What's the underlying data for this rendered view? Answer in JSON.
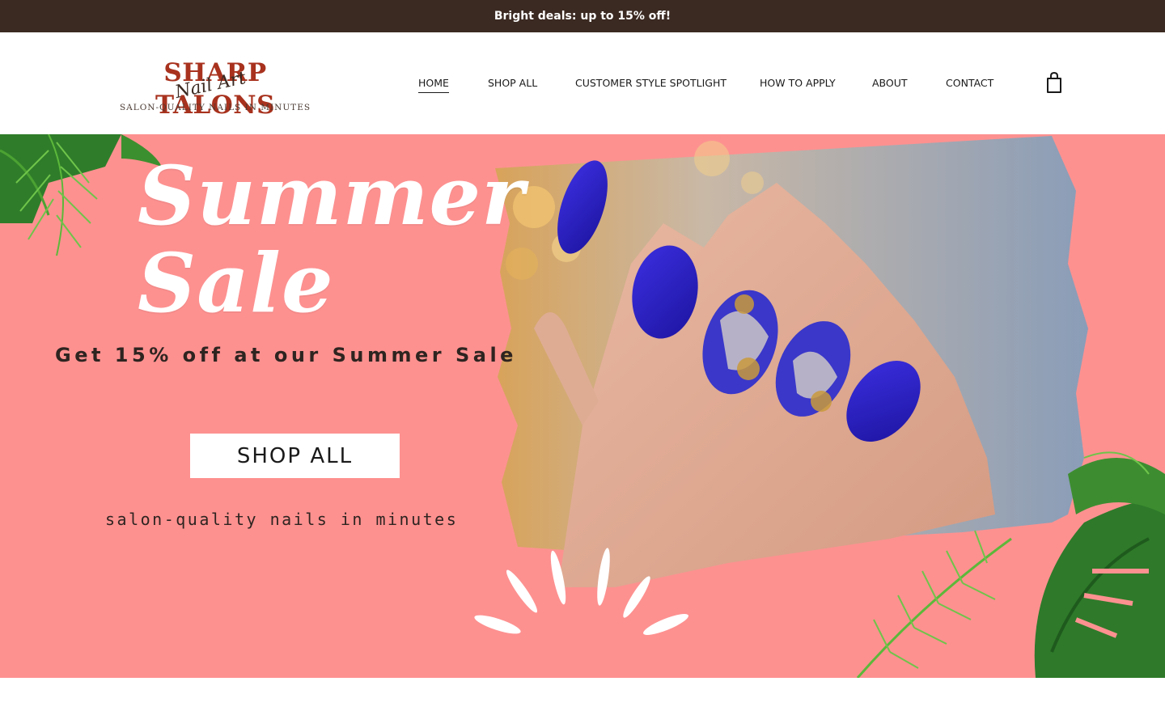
{
  "announcement": {
    "text": "Bright deals: up to 15% off!"
  },
  "brand": {
    "name": "SHARP TALONS",
    "script": "Nail Art",
    "tagline": "SALON-QUALITY NAILS IN MINUTES"
  },
  "nav": {
    "items": [
      {
        "label": "HOME",
        "active": true
      },
      {
        "label": "SHOP ALL"
      },
      {
        "label": "CUSTOMER STYLE SPOTLIGHT"
      },
      {
        "label": "HOW TO APPLY"
      },
      {
        "label": "ABOUT"
      },
      {
        "label": "CONTACT"
      }
    ],
    "cart_icon": "shopping-bag-icon"
  },
  "hero": {
    "title_line1": "Summer",
    "title_line2": "Sale",
    "subtitle": "Get 15% off at our Summer Sale",
    "button_label": "SHOP ALL",
    "tagline": "salon-quality nails in minutes",
    "background_color": "#fd9190",
    "image_icon": "manicured-hand-image",
    "decor_icons": [
      "palm-leaf-icon",
      "monstera-leaf-icon",
      "burst-lines-icon"
    ]
  },
  "colors": {
    "announcement_bg": "#3b2a22",
    "brand_red": "#a8321e",
    "nail_blue": "#2a1fb8",
    "hero_pink": "#fd9190"
  }
}
